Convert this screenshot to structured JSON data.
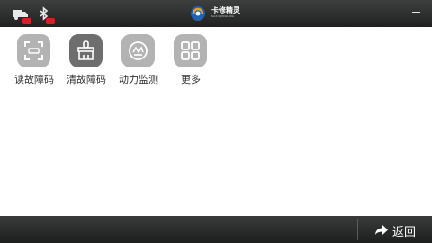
{
  "header": {
    "logo_text": "卡修精灵",
    "logo_subtext": "KAXIUJINGLING",
    "status_icons": [
      "truck-icon",
      "bluetooth-icon"
    ],
    "status_badge_color": "#d61f26"
  },
  "functions": [
    {
      "label": "读故障码",
      "icon": "scan-icon"
    },
    {
      "label": "清故障码",
      "icon": "broom-icon"
    },
    {
      "label": "动力监测",
      "icon": "engine-icon"
    },
    {
      "label": "更多",
      "icon": "grid-icon"
    }
  ],
  "footer": {
    "back_label": "返回"
  },
  "colors": {
    "bar": "#2b2c2c",
    "tile": "#b3b3b3",
    "tile_active": "#6e6e6e",
    "accent_red": "#d61f26"
  }
}
